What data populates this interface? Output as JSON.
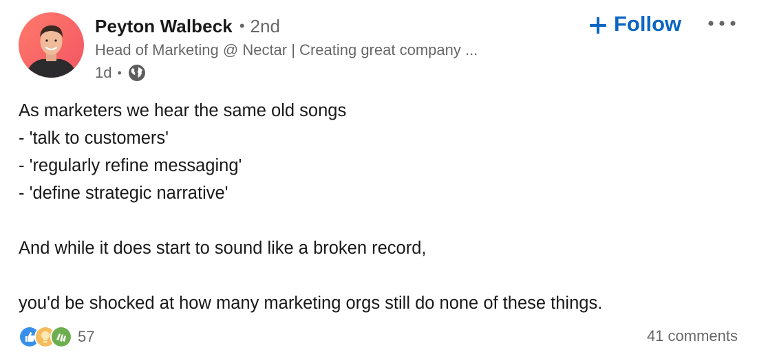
{
  "author": {
    "name": "Peyton Walbeck",
    "separator": "•",
    "degree": "2nd",
    "headline": "Head of Marketing @ Nectar | Creating great company ...",
    "posted_ago": "1d",
    "visibility_icon": "globe-icon",
    "avatar_bg": "#ff6b6b"
  },
  "actions": {
    "follow_label": "Follow",
    "follow_icon": "plus-icon",
    "more_icon": "more-options-icon",
    "accent": "#0a66c2"
  },
  "post": {
    "lines": [
      "As marketers we hear the same old songs",
      "- 'talk to customers'",
      "- 'regularly refine messaging'",
      "- 'define strategic narrative'",
      "",
      "And while it does start to sound like a broken record,",
      "",
      "you'd be shocked at how many marketing orgs still do none of these things."
    ]
  },
  "social": {
    "reaction_icons": [
      "like-icon",
      "insightful-icon",
      "celebrate-icon"
    ],
    "reaction_count": "57",
    "comments": "41 comments"
  }
}
